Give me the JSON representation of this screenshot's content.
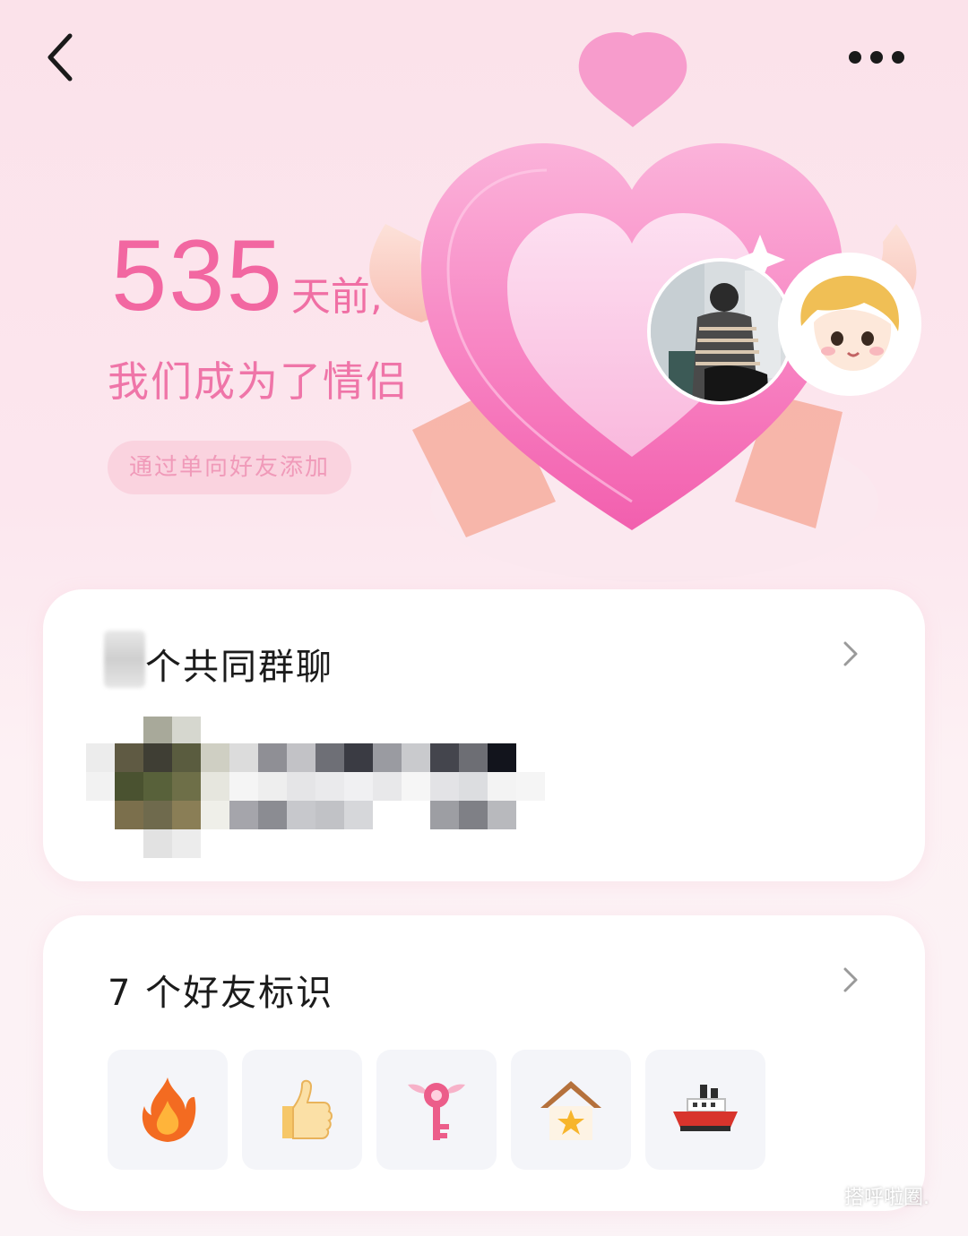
{
  "header": {
    "back_icon": "chevron-left-icon",
    "more_icon": "more-dots-icon"
  },
  "hero": {
    "days": "535",
    "days_suffix": "天前,",
    "couple_text": "我们成为了情侣",
    "via_text": "通过单向好友添加"
  },
  "groups_card": {
    "title": "个共同群聊",
    "count_hidden": true
  },
  "badges_card": {
    "title": "7 个好友标识",
    "badges": [
      "fire-icon",
      "thumbs-up-icon",
      "winged-key-icon",
      "house-star-icon",
      "ship-icon"
    ]
  },
  "watermark": {
    "text": "搭呼啦圈."
  },
  "colors": {
    "accent_pink": "#f267a1",
    "badge_bg": "#fad3df",
    "card_bg": "#ffffff"
  }
}
